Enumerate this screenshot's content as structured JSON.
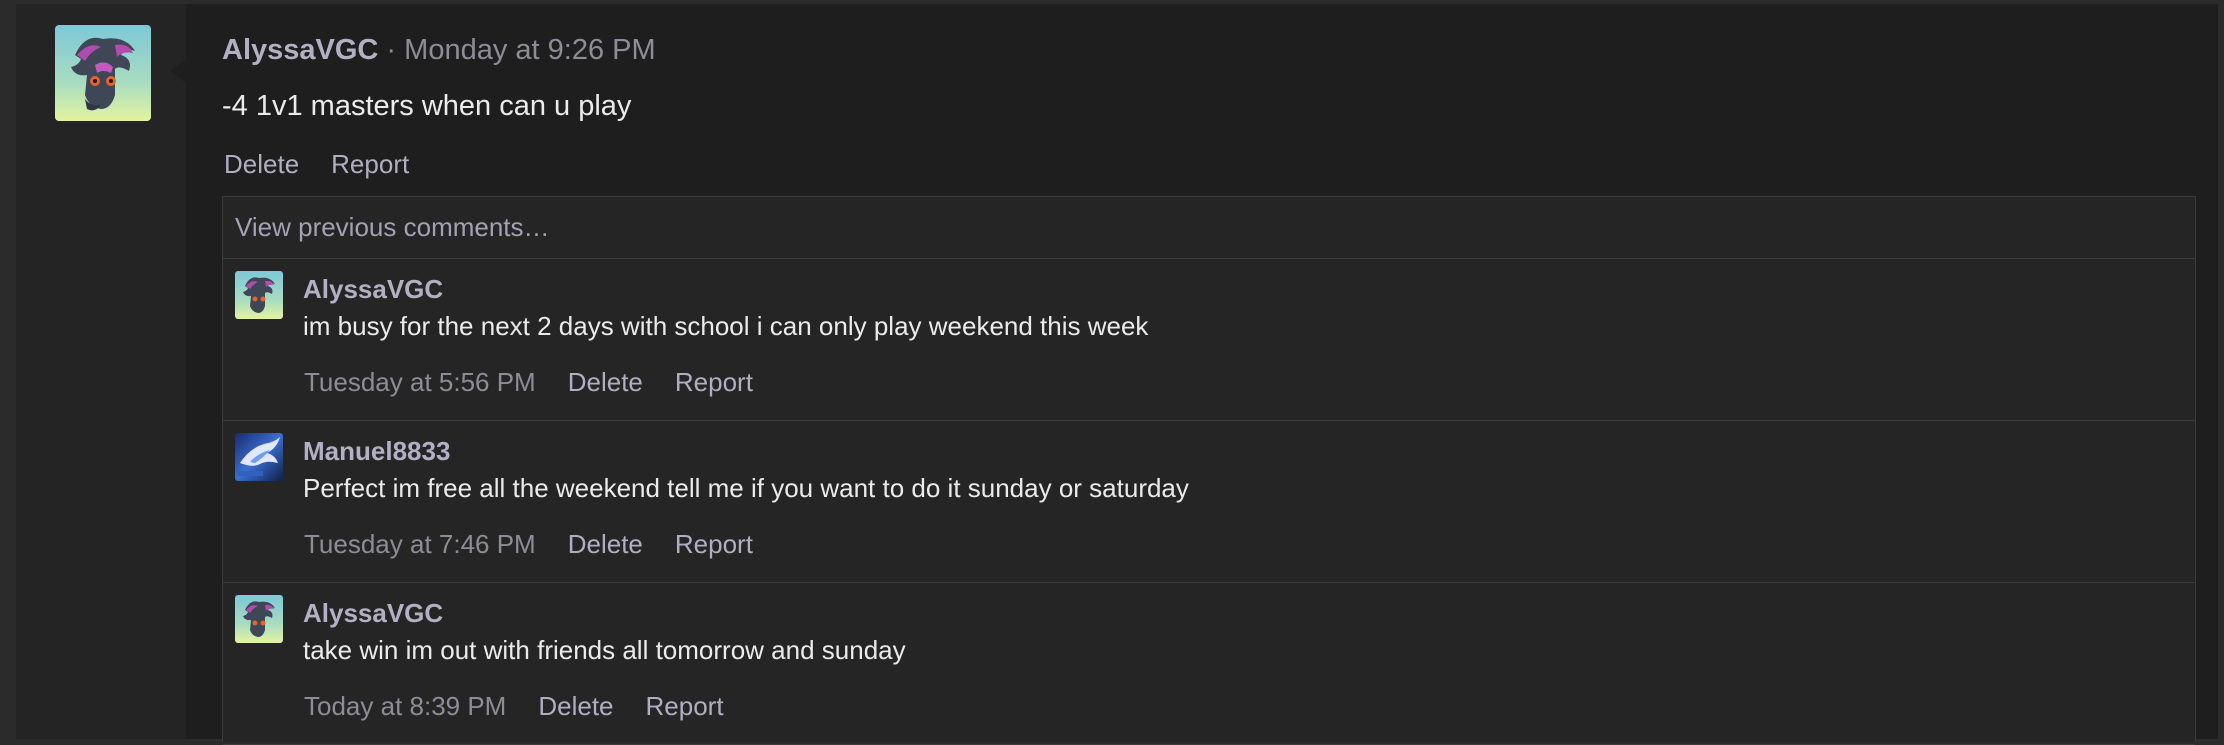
{
  "post": {
    "author": "AlyssaVGC",
    "separator": "·",
    "timestamp": "Monday at 9:26 PM",
    "text": "-4 1v1 masters when can u play",
    "actions": {
      "delete": "Delete",
      "report": "Report"
    },
    "avatar_icon": "misdreavus-avatar-icon"
  },
  "comments_section": {
    "view_previous": "View previous comments…",
    "items": [
      {
        "author": "AlyssaVGC",
        "text": "im busy for the next 2 days with school i can only play weekend this week",
        "timestamp": "Tuesday at 5:56 PM",
        "delete": "Delete",
        "report": "Report",
        "avatar_icon": "misdreavus-avatar-icon"
      },
      {
        "author": "Manuel8833",
        "text": "Perfect im free all the weekend tell me if you want to do it sunday or saturday",
        "timestamp": "Tuesday at 7:46 PM",
        "delete": "Delete",
        "report": "Report",
        "avatar_icon": "blue-bird-avatar-icon"
      },
      {
        "author": "AlyssaVGC",
        "text": "take win im out with friends all tomorrow and sunday",
        "timestamp": "Today at 8:39 PM",
        "delete": "Delete",
        "report": "Report",
        "avatar_icon": "misdreavus-avatar-icon"
      }
    ]
  },
  "colors": {
    "background": "#2b2b2b",
    "post_background": "#1e1e1e",
    "username": "#b3b0c4",
    "muted_text": "#8e8c96",
    "body_text": "#ebebeb",
    "border": "#3b3b3b"
  }
}
